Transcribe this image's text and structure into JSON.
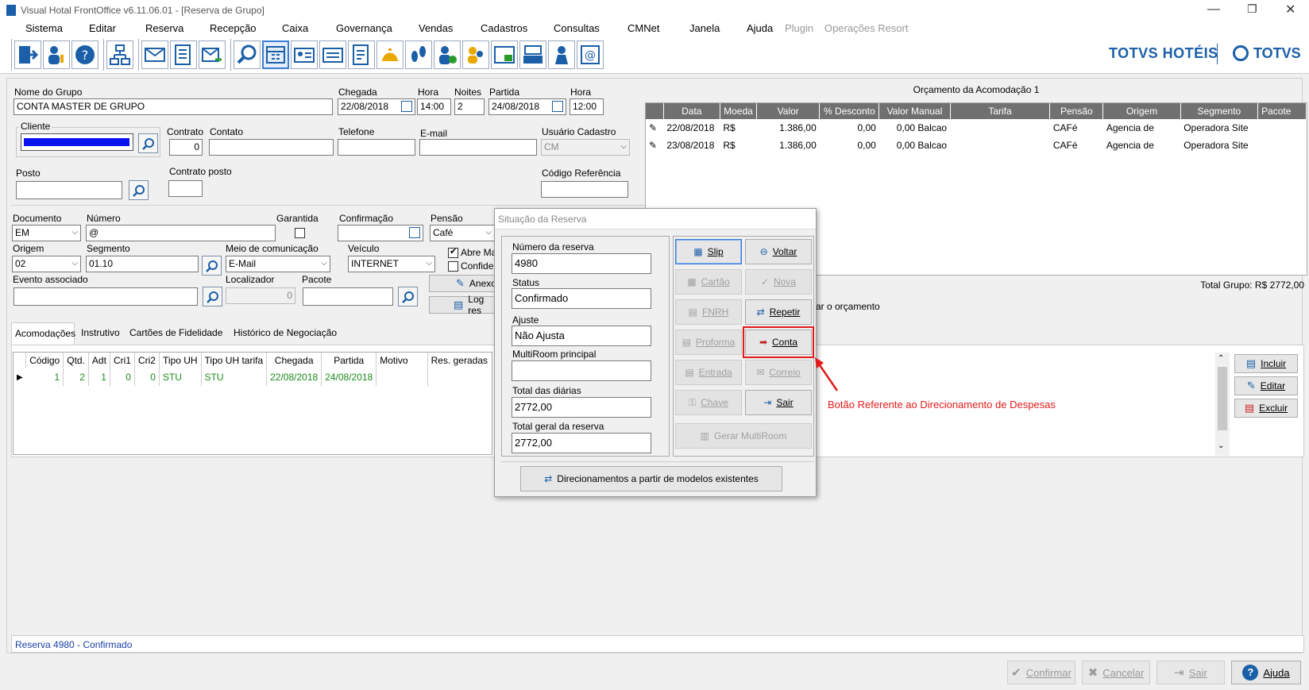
{
  "window": {
    "title": "Visual Hotal FrontOffice v6.11.06.01 - [Reserva de Grupo]"
  },
  "menu": [
    "Sistema",
    "Editar",
    "Reserva",
    "Recepção",
    "Caixa",
    "Governança",
    "Vendas",
    "Cadastros",
    "Consultas",
    "CMNet",
    "Janela",
    "Ajuda",
    "Plugin",
    "Operações Resort"
  ],
  "brand": {
    "left": "TOTVS HOTÉIS",
    "right": "TOTVS",
    "color": "#1a5fa8"
  },
  "form": {
    "nome_grupo_label": "Nome do Grupo",
    "nome_grupo": "CONTA MASTER DE GRUPO",
    "chegada_label": "Chegada",
    "chegada": "22/08/2018",
    "hora1_label": "Hora",
    "hora1": "14:00",
    "noites_label": "Noites",
    "noites": "2",
    "partida_label": "Partida",
    "partida": "24/08/2018",
    "hora2_label": "Hora",
    "hora2": "12:00",
    "cliente_label": "Cliente",
    "contrato_label": "Contrato",
    "contrato": "0",
    "contato_label": "Contato",
    "telefone_label": "Telefone",
    "email_label": "E-mail",
    "usuario_label": "Usuário Cadastro",
    "usuario": "CM",
    "posto_label": "Posto",
    "contrato_posto_label": "Contrato posto",
    "codigo_ref_label": "Código Referência",
    "documento_label": "Documento",
    "documento": "EM",
    "numero_label": "Número",
    "numero": "@",
    "garantida_label": "Garantida",
    "confirmacao_label": "Confirmação",
    "pensao_label": "Pensão",
    "pensao": "Café",
    "origem_label": "Origem",
    "origem": "02",
    "segmento_label": "Segmento",
    "segmento": "01.10",
    "meio_label": "Meio de comunicação",
    "meio": "E-Mail",
    "veiculo_label": "Veículo",
    "veiculo": "INTERNET",
    "abre_label": "Abre Ma",
    "confide_label": "Confide",
    "evento_label": "Evento associado",
    "localizador_label": "Localizador",
    "localizador": "0",
    "pacote_label": "Pacote",
    "anexo_label": "Anexo",
    "log_label": "Log res"
  },
  "orcamento": {
    "title": "Orçamento da Acomodação 1",
    "columns": [
      "Data",
      "Moeda",
      "Valor",
      "% Desconto",
      "Valor Manual",
      "Tarifa",
      "Pensão",
      "Origem",
      "Segmento",
      "Pacote"
    ],
    "rows": [
      [
        "22/08/2018",
        "R$",
        "1.386,00",
        "0,00",
        "0,00 Balcao",
        "",
        "CAFé",
        "Agencia de",
        "Operadora Site",
        ""
      ],
      [
        "23/08/2018",
        "R$",
        "1.386,00",
        "0,00",
        "0,00 Balcao",
        "",
        "CAFé",
        "Agencia de",
        "Operadora Site",
        ""
      ]
    ],
    "total_grupo": "Total Grupo: R$ 2772,00",
    "orcamento_text": "ar o orçamento"
  },
  "tabs": [
    "Acomodações",
    "Instrutivo",
    "Cartões de Fidelidade",
    "Histórico  de Negociação"
  ],
  "acomodacoes": {
    "columns": [
      "Código",
      "Qtd.",
      "Adt",
      "Cri1",
      "Cri2",
      "Tipo UH",
      "Tipo UH tarifa",
      "Chegada",
      "Partida",
      "Motivo",
      "Res. geradas"
    ],
    "rows": [
      [
        "1",
        "2",
        "1",
        "0",
        "0",
        "STU",
        "STU",
        "22/08/2018",
        "24/08/2018",
        "",
        ""
      ]
    ],
    "buttons": {
      "incluir": "Incluir",
      "editar": "Editar",
      "excluir": "Excluir"
    }
  },
  "status_bar": "Reserva 4980 - Confirmado",
  "bottom_buttons": {
    "confirmar": "Confirmar",
    "cancelar": "Cancelar",
    "sair": "Sair",
    "ajuda": "Ajuda"
  },
  "dialog": {
    "title": "Situação da Reserva",
    "numero_label": "Número da reserva",
    "numero": "4980",
    "status_label": "Status",
    "status": "Confirmado",
    "ajuste_label": "Ajuste",
    "ajuste": "Não Ajusta",
    "multiroom_label": "MultiRoom principal",
    "multiroom": "",
    "total_diarias_label": "Total das diárias",
    "total_diarias": "2772,00",
    "total_geral_label": "Total geral da reserva",
    "total_geral": "2772,00",
    "buttons": {
      "slip": "Slip",
      "voltar": "Voltar",
      "cartao": "Cartão",
      "nova": "Nova",
      "fnrh": "FNRH",
      "repetir": "Repetir",
      "proforma": "Proforma",
      "conta": "Conta",
      "entrada": "Entrada",
      "correio": "Correio",
      "chave": "Chave",
      "sair": "Sair",
      "gerar_multiroom": "Gerar MultiRoom"
    },
    "direcionamentos": "Direcionamentos a partir de modelos existentes"
  },
  "annotation": {
    "text": "Botão Referente ao Direcionamento de Despesas",
    "color": "#e21a1a"
  }
}
